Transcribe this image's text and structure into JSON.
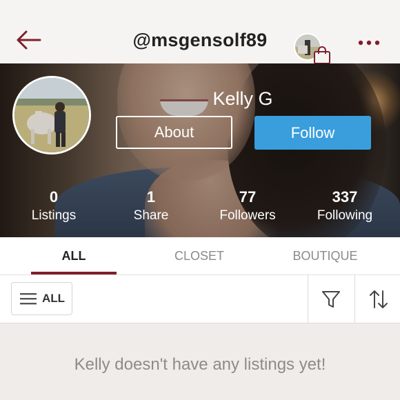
{
  "header": {
    "username": "@msgensolf89",
    "back_icon": "arrow-left-icon",
    "bag_icon": "shopping-bag-icon",
    "more_icon": "more-dots-icon"
  },
  "profile": {
    "name": "Kelly G",
    "about_label": "About",
    "follow_label": "Follow"
  },
  "stats": [
    {
      "value": "0",
      "label": "Listings"
    },
    {
      "value": "1",
      "label": "Share"
    },
    {
      "value": "77",
      "label": "Followers"
    },
    {
      "value": "337",
      "label": "Following"
    }
  ],
  "tabs": [
    {
      "label": "ALL",
      "active": true
    },
    {
      "label": "CLOSET",
      "active": false
    },
    {
      "label": "BOUTIQUE",
      "active": false
    }
  ],
  "filter_bar": {
    "all_label": "ALL",
    "filter_icon": "funnel-icon",
    "sort_icon": "sort-arrows-icon"
  },
  "empty_message": "Kelly doesn't have any listings yet!",
  "colors": {
    "accent": "#7f1f2d",
    "follow_button": "#3a9edc",
    "background": "#efecea"
  }
}
